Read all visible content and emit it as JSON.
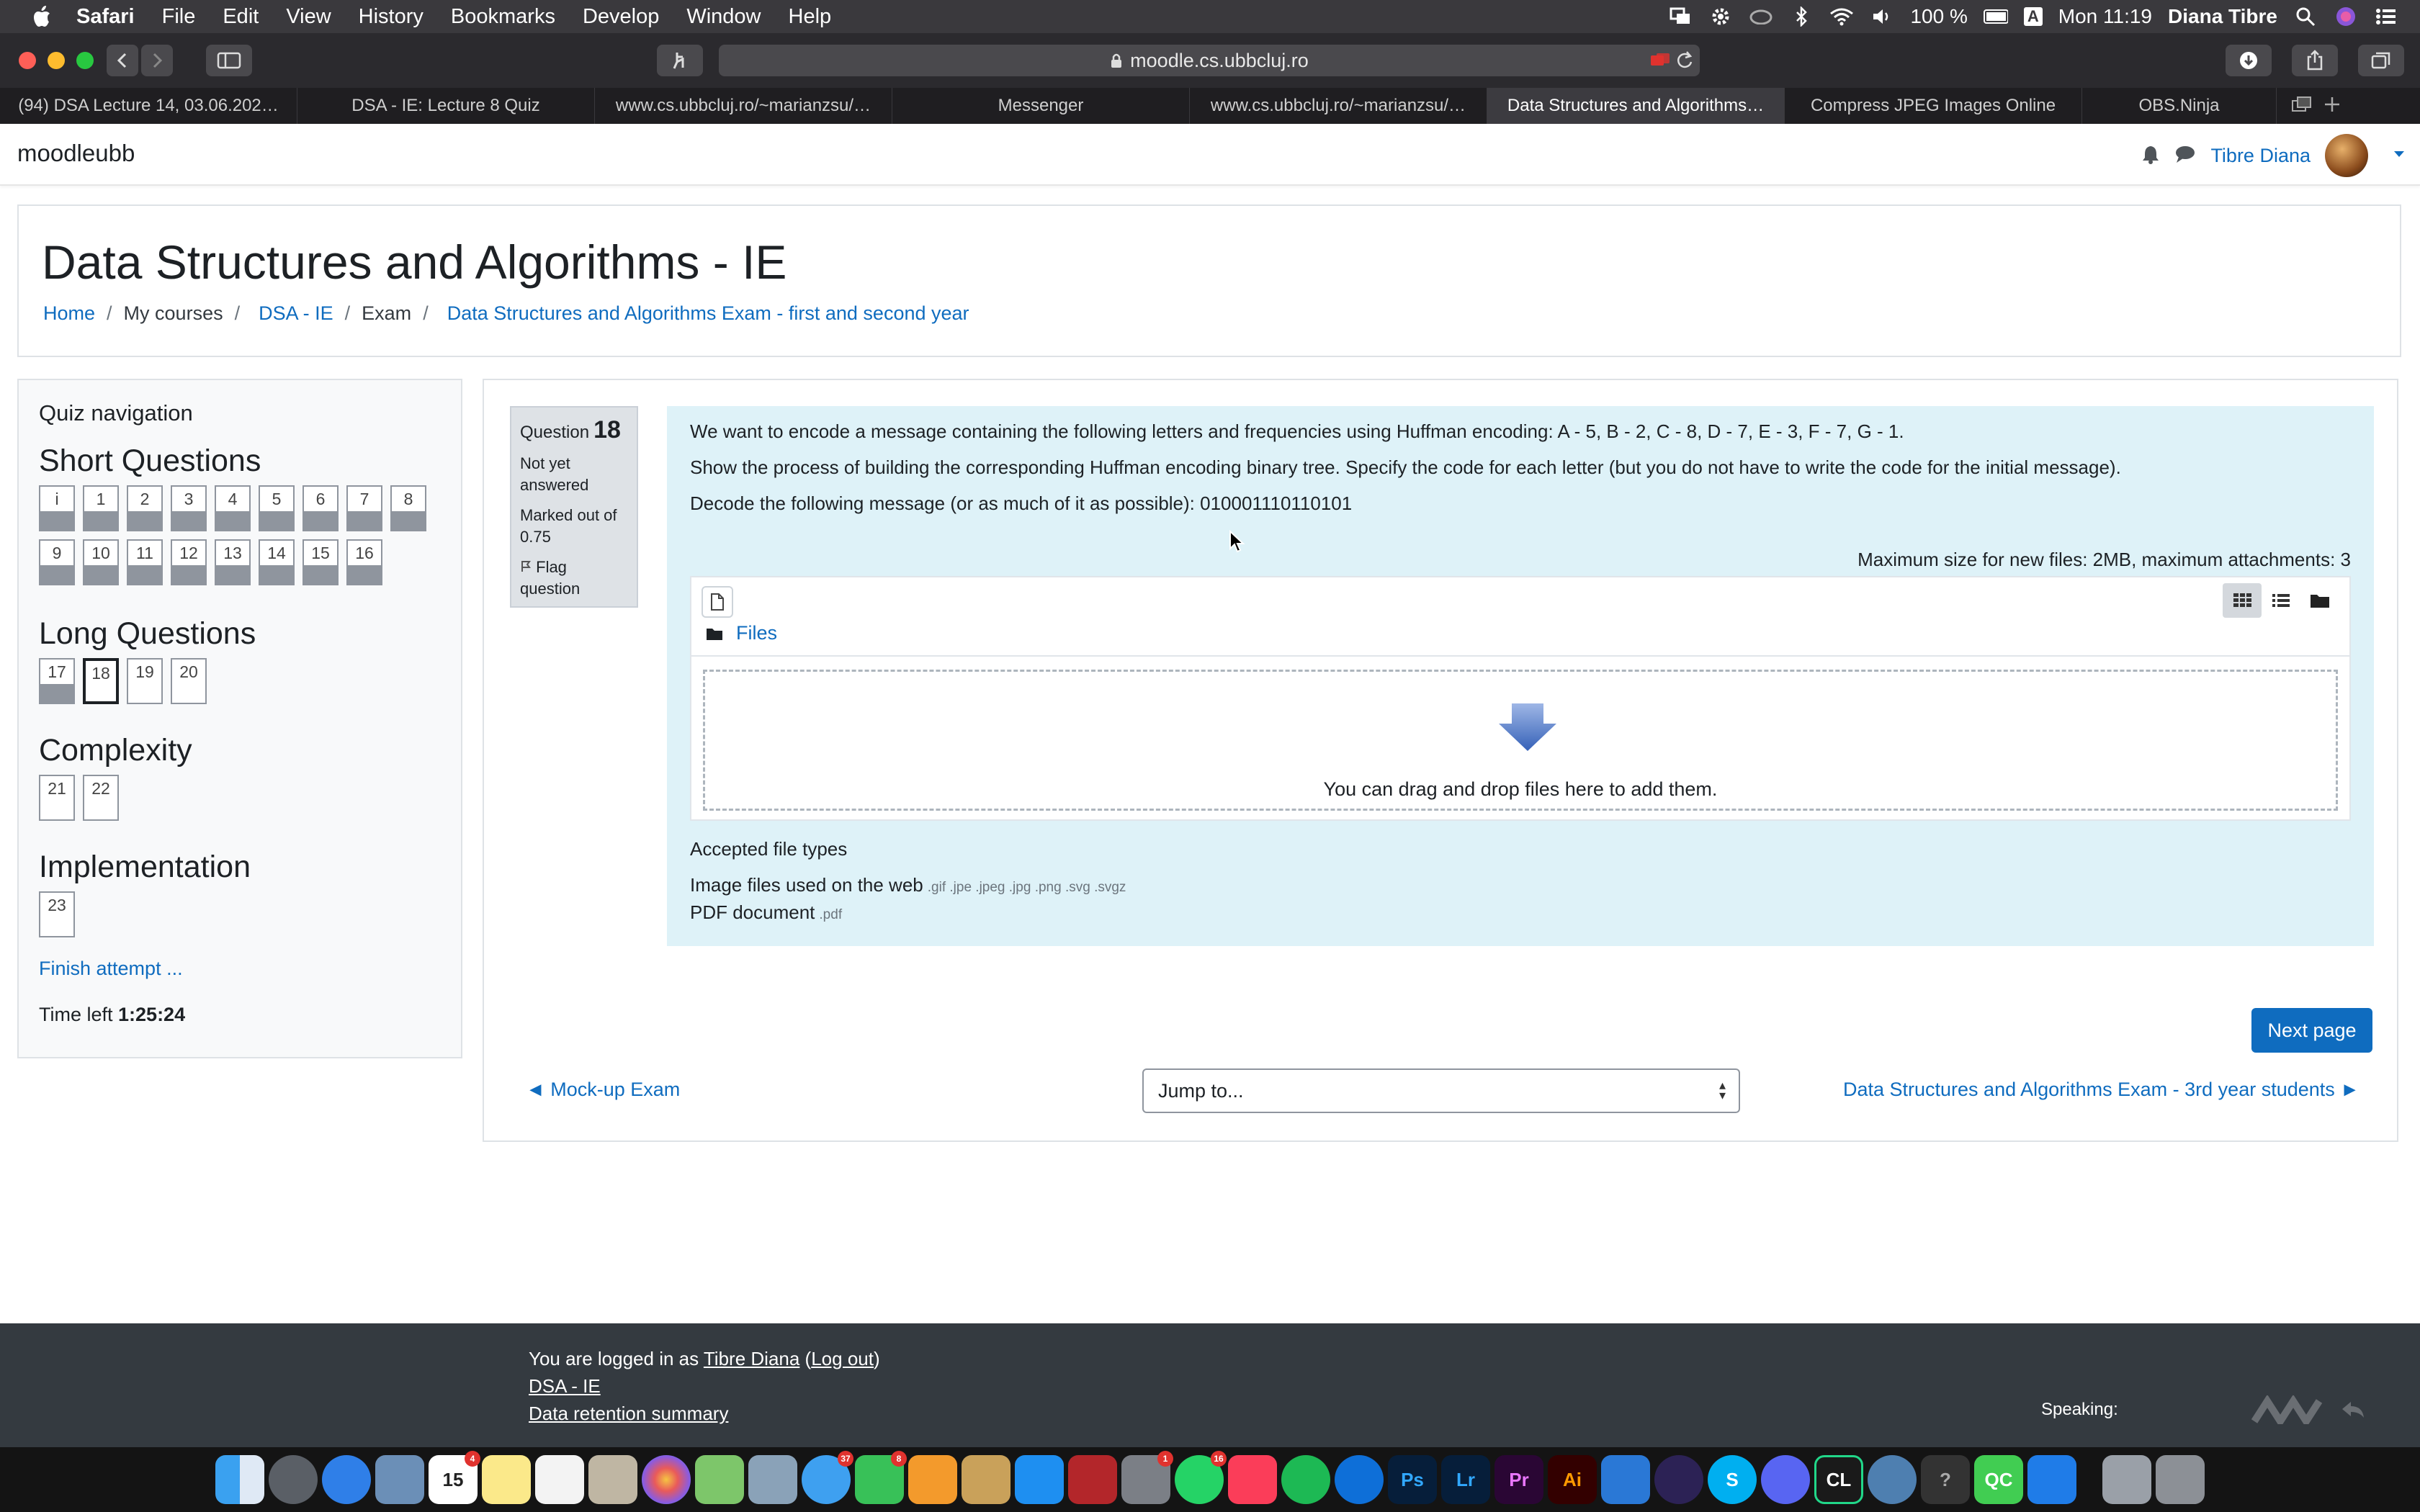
{
  "menubar": {
    "app": "Safari",
    "items": [
      "File",
      "Edit",
      "View",
      "History",
      "Bookmarks",
      "Develop",
      "Window",
      "Help"
    ],
    "battery": "100 %",
    "input_source": "A",
    "clock": "Mon 11:19",
    "user": "Diana Tibre"
  },
  "browser": {
    "url": "moodle.cs.ubbcluj.ro",
    "tabs": [
      {
        "label": "(94) DSA Lecture 14, 03.06.202…"
      },
      {
        "label": "DSA - IE: Lecture 8 Quiz"
      },
      {
        "label": "www.cs.ubbcluj.ro/~marianzsu/…"
      },
      {
        "label": "Messenger"
      },
      {
        "label": "www.cs.ubbcluj.ro/~marianzsu/…"
      },
      {
        "label": "Data Structures and Algorithms…"
      },
      {
        "label": "Compress JPEG Images Online"
      },
      {
        "label": "OBS.Ninja"
      }
    ]
  },
  "site": {
    "brand": "moodleubb",
    "user_name": "Tibre Diana"
  },
  "header": {
    "title": "Data Structures and Algorithms - IE",
    "breadcrumb": {
      "home": "Home",
      "my_courses": "My courses",
      "course": "DSA - IE",
      "section": "Exam",
      "activity": "Data Structures and Algorithms Exam - first and second year"
    }
  },
  "quiz_nav": {
    "title": "Quiz navigation",
    "sections": [
      {
        "name": "Short Questions",
        "items": [
          "i",
          "1",
          "2",
          "3",
          "4",
          "5",
          "6",
          "7",
          "8",
          "9",
          "10",
          "11",
          "12",
          "13",
          "14",
          "15",
          "16"
        ]
      },
      {
        "name": "Long Questions",
        "items": [
          "17",
          "18",
          "19",
          "20"
        ]
      },
      {
        "name": "Complexity",
        "items": [
          "21",
          "22"
        ]
      },
      {
        "name": "Implementation",
        "items": [
          "23"
        ]
      }
    ],
    "finish": "Finish attempt ...",
    "time_label": "Time left",
    "time_value": "1:25:24"
  },
  "question": {
    "label": "Question",
    "number": "18",
    "status": "Not yet answered",
    "marked": "Marked out of 0.75",
    "flag": "Flag question",
    "text1": "We want to encode a message containing the following letters and frequencies using Huffman encoding: A - 5, B - 2, C - 8, D - 7, E - 3, F - 7, G - 1.",
    "text2": "Show the process of building the corresponding Huffman encoding binary tree. Specify the code for each letter (but you do not have to write the code for the initial message).",
    "text3": "Decode the following message (or as much of it as possible): 010001110110101",
    "max_size": "Maximum size for new files: 2MB, maximum attachments: 3",
    "files_label": "Files",
    "drop_text": "You can drag and drop files here to add them.",
    "accepted_label": "Accepted file types",
    "type1_name": "Image files used on the web",
    "type1_ext": ".gif .jpe .jpeg .jpg .png .svg .svgz",
    "type2_name": "PDF document",
    "type2_ext": ".pdf"
  },
  "navigation": {
    "next_page": "Next page",
    "prev_link": "◄ Mock-up Exam",
    "jump_placeholder": "Jump to...",
    "next_link": "Data Structures and Algorithms Exam - 3rd year students ►"
  },
  "footer": {
    "logged_prefix": "You are logged in as",
    "logged_user": "Tibre Diana",
    "logout": "Log out",
    "course_link": "DSA - IE",
    "retention": "Data retention summary",
    "speaking": "Speaking:"
  },
  "dock": {
    "calendar_day": "15",
    "badges": {
      "calendar": "4",
      "messages": "37",
      "facetime": "8",
      "settings": "1",
      "whatsapp": "16"
    }
  },
  "colors": {
    "link": "#0f6cbf",
    "question_bg": "#def2f8",
    "info_bg": "#dee2e6",
    "footer_bg": "#343a40"
  }
}
